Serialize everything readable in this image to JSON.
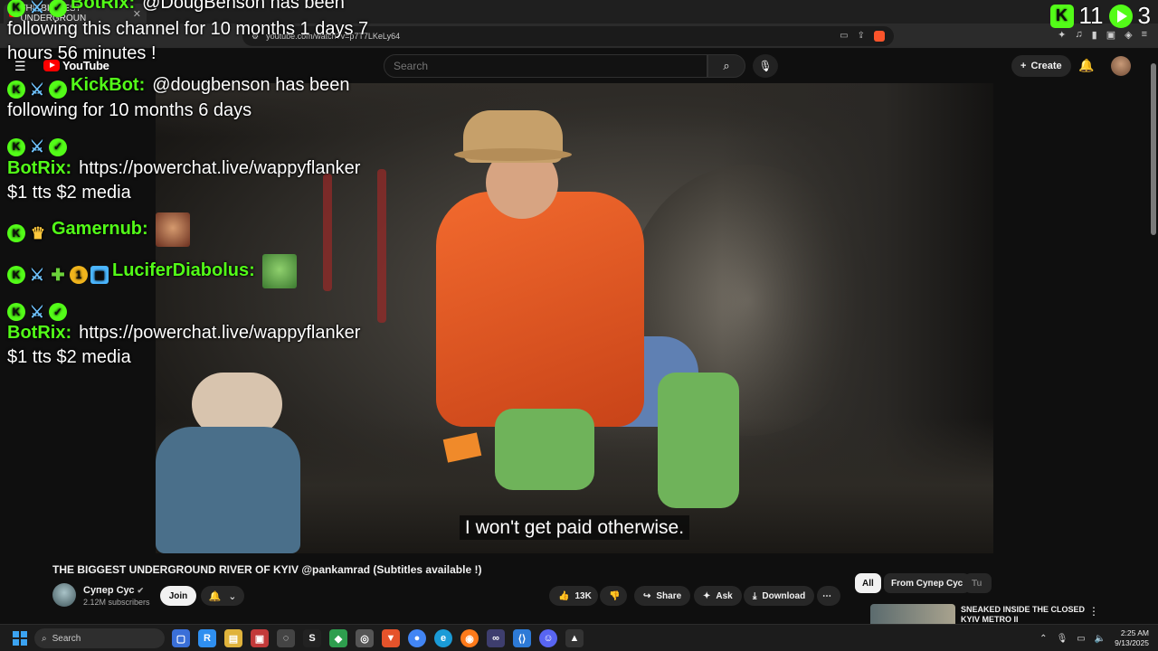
{
  "browser": {
    "tab_title": "THE BIGGEST UNDERGROUN",
    "url": "youtube.com/watch?v=p7T7LKeLy64"
  },
  "youtube": {
    "logo_text": "YouTube",
    "search_placeholder": "Search",
    "create_label": "Create"
  },
  "kick_counter": {
    "count": "11",
    "viewers": "3"
  },
  "chat": {
    "messages": [
      {
        "user": "BotRix:",
        "text": "@DougBenson has been following this channel for 10 months 1 days 7 hours 56 minutes !"
      },
      {
        "user": "KickBot:",
        "text": "@dougbenson has been following for 10 months 6 days"
      },
      {
        "user": "BotRix:",
        "text": "https://powerchat.live/wappyflanker $1 tts $2 media"
      },
      {
        "user": "Gamernub:",
        "text": ""
      },
      {
        "user": "LuciferDiabolus:",
        "text": ""
      },
      {
        "user": "BotRix:",
        "text": "https://powerchat.live/wappyflanker $1 tts $2 media"
      }
    ]
  },
  "video": {
    "subtitle": "I won't get paid otherwise.",
    "title": "THE BIGGEST UNDERGROUND RIVER OF KYIV @pankamrad (Subtitles available !)",
    "channel": "Супер Сус",
    "subscribers": "2.12M subscribers",
    "join_label": "Join",
    "likes": "13K",
    "share_label": "Share",
    "ask_label": "Ask",
    "download_label": "Download"
  },
  "sidebar": {
    "chips": [
      "All",
      "From Супер Сус",
      "Tu"
    ],
    "rec_title": "SNEAKED INSIDE THE CLOSED KYIV METRO II"
  },
  "taskbar": {
    "search_label": "Search",
    "time": "2:25 AM",
    "date": "9/13/2025"
  }
}
